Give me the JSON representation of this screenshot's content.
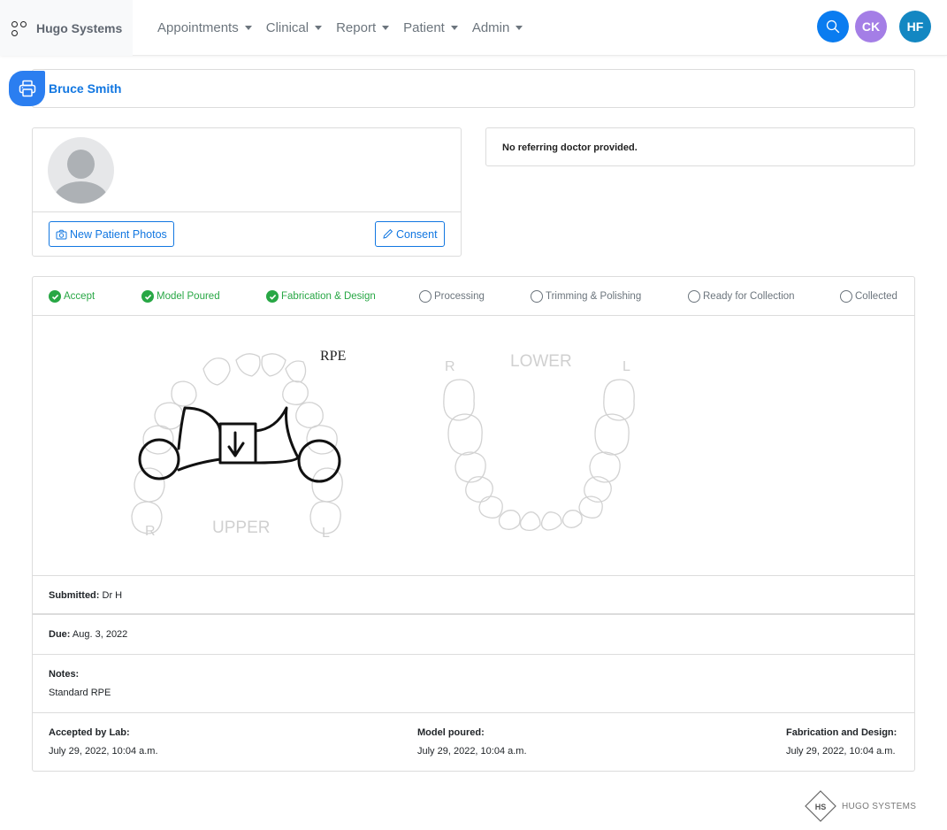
{
  "navbar": {
    "brand": "Hugo Systems",
    "menu": [
      {
        "label": "Appointments"
      },
      {
        "label": "Clinical"
      },
      {
        "label": "Report"
      },
      {
        "label": "Patient"
      },
      {
        "label": "Admin"
      }
    ],
    "search_icon": "search-icon",
    "users": [
      {
        "initials": "CK",
        "color": "#a47ee6"
      },
      {
        "initials": "HF",
        "color": "#1387c2"
      }
    ]
  },
  "patient": {
    "name": "Bruce Smith",
    "print_icon": "printer-icon"
  },
  "photo_card": {
    "new_photos_label": "New Patient Photos",
    "consent_label": "Consent"
  },
  "referring": {
    "text": "No referring doctor provided."
  },
  "steps": [
    {
      "label": "Accept",
      "done": true
    },
    {
      "label": "Model Poured",
      "done": true
    },
    {
      "label": "Fabrication & Design",
      "done": true
    },
    {
      "label": "Processing",
      "done": false
    },
    {
      "label": "Trimming & Polishing",
      "done": false
    },
    {
      "label": "Ready for Collection",
      "done": false
    },
    {
      "label": "Collected",
      "done": false
    }
  ],
  "dental_chart": {
    "annotation": "RPE",
    "upper": {
      "label": "UPPER",
      "right": "R",
      "left": "L"
    },
    "lower": {
      "label": "LOWER",
      "right": "R",
      "left": "L"
    }
  },
  "details": {
    "submitted_label": "Submitted:",
    "submitted_value": "Dr H",
    "due_label": "Due:",
    "due_value": "Aug. 3, 2022",
    "notes_label": "Notes:",
    "notes_value": "Standard RPE"
  },
  "history": [
    {
      "label": "Accepted by Lab:",
      "value": "July 29, 2022, 10:04 a.m."
    },
    {
      "label": "Model poured:",
      "value": "July 29, 2022, 10:04 a.m."
    },
    {
      "label": "Fabrication and Design:",
      "value": "July 29, 2022, 10:04 a.m."
    }
  ],
  "footer": {
    "logo_mark": "HS",
    "logo_text": "HUGO SYSTEMS"
  },
  "colors": {
    "primary": "#1277e1",
    "success": "#28a745",
    "muted": "#6c757d"
  }
}
